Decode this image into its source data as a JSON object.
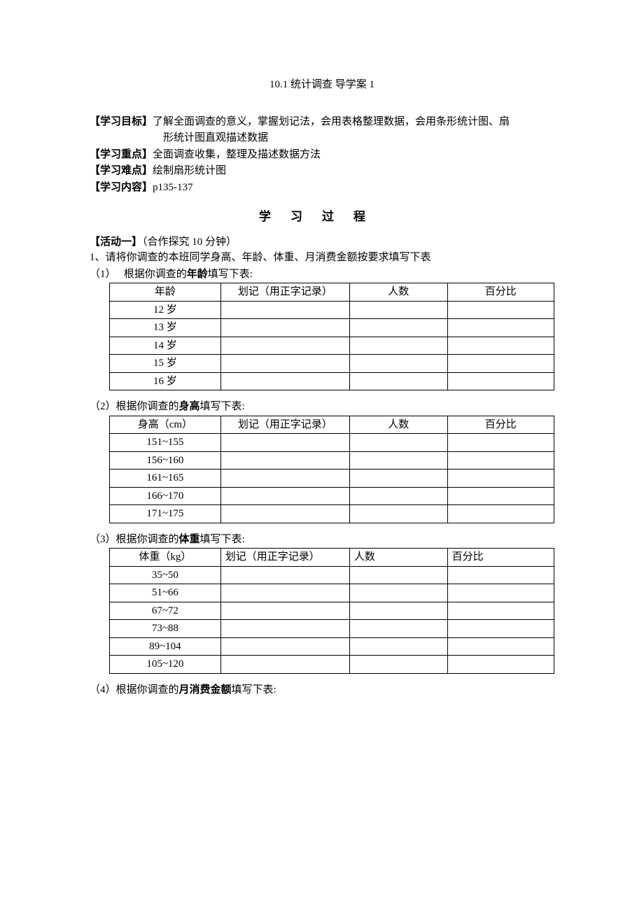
{
  "title": "10.1 统计调查 导学案 1",
  "meta": {
    "goal_label": "【学习目标】",
    "goal_line1": "了解全面调查的意义，掌握划记法，会用表格整理数据，会用条形统计图、扇",
    "goal_line2": "形统计图直观描述数据",
    "focus_label": "【学习重点】",
    "focus_text": "全面调查收集，整理及描述数据方法",
    "difficulty_label": "【学习难点】",
    "difficulty_text": "绘制扇形统计图",
    "content_label": "【学习内容】",
    "content_text": "p135-137"
  },
  "process_heading": "学习过程",
  "activity": {
    "label": "【活动一】",
    "suffix": "（合作探究 10 分钟）",
    "prompt": "1、请将你调查的本班同学身高、年龄、体重、月消费金额按要求填写下表"
  },
  "sub1": {
    "prefix": "（1）   根据你调查的",
    "bold": "年龄",
    "suffix": "填写下表:"
  },
  "sub2": {
    "prefix": "（2）根据你调查的",
    "bold": "身高",
    "suffix": "填写下表:"
  },
  "sub3": {
    "prefix": "（3）根据你调查的",
    "bold": "体重",
    "suffix": "填写下表:"
  },
  "sub4": {
    "prefix": "（4）根据你调查的",
    "bold": "月消费金额",
    "suffix": "填写下表:"
  },
  "headers": {
    "tally": "划记（用正字记录）",
    "count": "人数",
    "pct": "百分比"
  },
  "table1": {
    "col1_header": "年龄",
    "rows": [
      "12 岁",
      "13 岁",
      "14 岁",
      "15 岁",
      "16 岁"
    ]
  },
  "table2": {
    "col1_header": "身高（cm）",
    "rows": [
      "151~155",
      "156~160",
      "161~165",
      "166~170",
      "171~175"
    ]
  },
  "table3": {
    "col1_header": "体重（kg）",
    "rows": [
      "35~50",
      "51~66",
      "67~72",
      "73~88",
      "89~104",
      "105~120"
    ]
  }
}
